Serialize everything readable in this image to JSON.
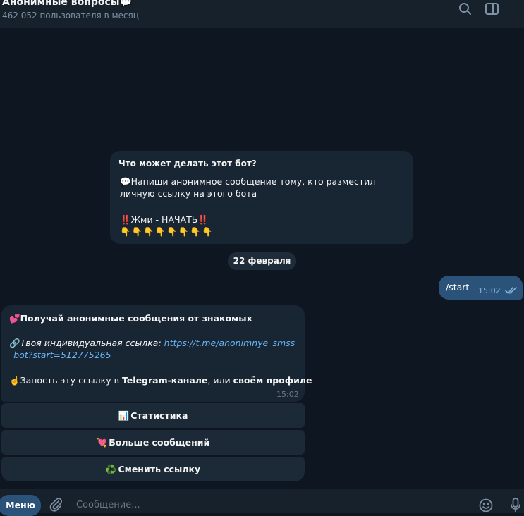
{
  "header": {
    "title": "Анонимные вопросы💬",
    "subtitle": "462 052 пользователя в месяц",
    "icons": {
      "search": "search-icon",
      "panel": "sidebar-toggle-icon"
    }
  },
  "intro_card": {
    "heading": "Что может делать этот бот?",
    "body": "💬Напиши анонимное сообщение тому, кто разместил личную ссылку на этого бота",
    "cta": "‼️Жми - НАЧАТЬ‼️",
    "pointers": "👇👇👇👇👇👇👇👇"
  },
  "date_separator": "22 февраля",
  "outgoing": {
    "text": "/start",
    "time": "15:02"
  },
  "incoming": {
    "line1": "💕Получай анонимные сообщения от знакомых",
    "link_prefix": "🔗",
    "link_label": "Твоя индивидуальная ссылка: ",
    "link_url": "https://t.me/anonimnye_smss_bot?start=512775265",
    "line3_pre": "☝️Запость эту ссылку в ",
    "line3_b1": "Telegram-канале",
    "line3_mid": ", или ",
    "line3_b2": "своём профиле",
    "time": "15:02"
  },
  "keyboard": [
    {
      "emoji": "📊",
      "label": "Статистика"
    },
    {
      "emoji": "💘",
      "label": "Больше сообщений"
    },
    {
      "emoji": "♻️",
      "label": "Сменить ссылку"
    }
  ],
  "composer": {
    "menu_label": "Меню",
    "placeholder": "Сообщение...",
    "value": ""
  },
  "colors": {
    "background": "#0e1621",
    "header": "#17212b",
    "incoming_bubble": "#182533",
    "outgoing_bubble": "#2b5278",
    "link": "#6ab3f3",
    "muted": "#7f91a4"
  }
}
